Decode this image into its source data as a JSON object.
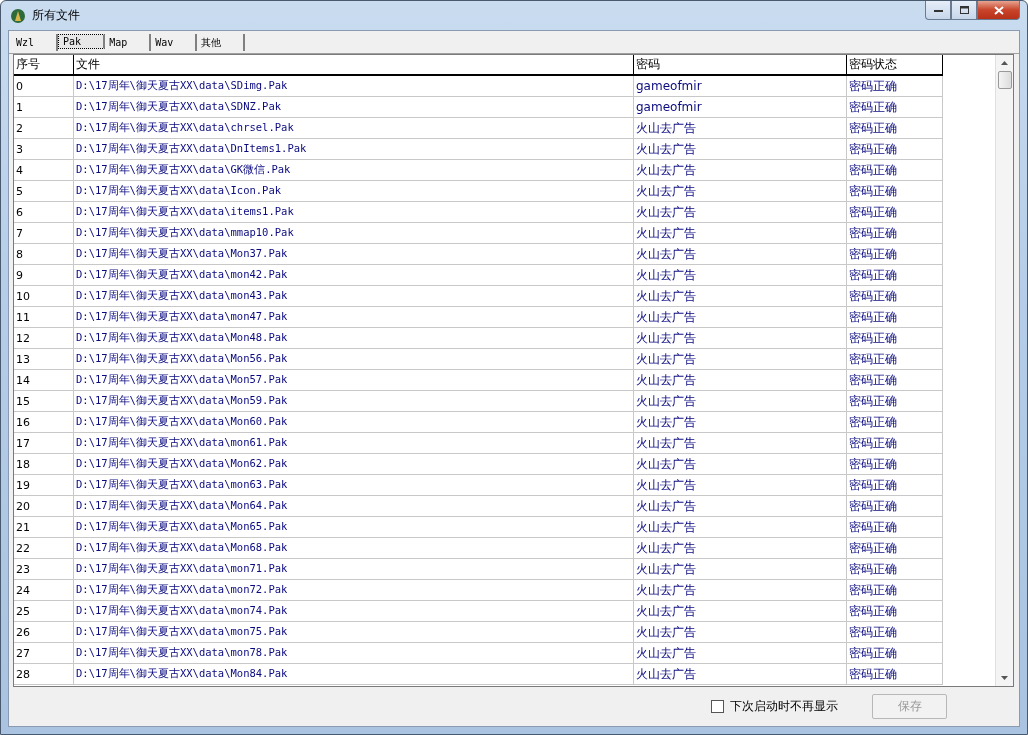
{
  "window": {
    "title": "所有文件"
  },
  "tabs": [
    {
      "label": "Wzl",
      "selected": false
    },
    {
      "label": "Pak",
      "selected": true
    },
    {
      "label": "Map",
      "selected": false
    },
    {
      "label": "Wav",
      "selected": false
    },
    {
      "label": "其他",
      "selected": false
    }
  ],
  "table": {
    "columns": [
      "序号",
      "文件",
      "密码",
      "密码状态"
    ],
    "rows": [
      {
        "no": "0",
        "file": "D:\\17周年\\御天夏古XX\\data\\SDimg.Pak",
        "password": "gameofmir",
        "status": "密码正确"
      },
      {
        "no": "1",
        "file": "D:\\17周年\\御天夏古XX\\data\\SDNZ.Pak",
        "password": "gameofmir",
        "status": "密码正确"
      },
      {
        "no": "2",
        "file": "D:\\17周年\\御天夏古XX\\data\\chrsel.Pak",
        "password": "火山去广告",
        "status": "密码正确"
      },
      {
        "no": "3",
        "file": "D:\\17周年\\御天夏古XX\\data\\DnItems1.Pak",
        "password": "火山去广告",
        "status": "密码正确"
      },
      {
        "no": "4",
        "file": "D:\\17周年\\御天夏古XX\\data\\GK微信.Pak",
        "password": "火山去广告",
        "status": "密码正确"
      },
      {
        "no": "5",
        "file": "D:\\17周年\\御天夏古XX\\data\\Icon.Pak",
        "password": "火山去广告",
        "status": "密码正确"
      },
      {
        "no": "6",
        "file": "D:\\17周年\\御天夏古XX\\data\\items1.Pak",
        "password": "火山去广告",
        "status": "密码正确"
      },
      {
        "no": "7",
        "file": "D:\\17周年\\御天夏古XX\\data\\mmap10.Pak",
        "password": "火山去广告",
        "status": "密码正确"
      },
      {
        "no": "8",
        "file": "D:\\17周年\\御天夏古XX\\data\\Mon37.Pak",
        "password": "火山去广告",
        "status": "密码正确"
      },
      {
        "no": "9",
        "file": "D:\\17周年\\御天夏古XX\\data\\mon42.Pak",
        "password": "火山去广告",
        "status": "密码正确"
      },
      {
        "no": "10",
        "file": "D:\\17周年\\御天夏古XX\\data\\mon43.Pak",
        "password": "火山去广告",
        "status": "密码正确"
      },
      {
        "no": "11",
        "file": "D:\\17周年\\御天夏古XX\\data\\mon47.Pak",
        "password": "火山去广告",
        "status": "密码正确"
      },
      {
        "no": "12",
        "file": "D:\\17周年\\御天夏古XX\\data\\Mon48.Pak",
        "password": "火山去广告",
        "status": "密码正确"
      },
      {
        "no": "13",
        "file": "D:\\17周年\\御天夏古XX\\data\\Mon56.Pak",
        "password": "火山去广告",
        "status": "密码正确"
      },
      {
        "no": "14",
        "file": "D:\\17周年\\御天夏古XX\\data\\Mon57.Pak",
        "password": "火山去广告",
        "status": "密码正确"
      },
      {
        "no": "15",
        "file": "D:\\17周年\\御天夏古XX\\data\\Mon59.Pak",
        "password": "火山去广告",
        "status": "密码正确"
      },
      {
        "no": "16",
        "file": "D:\\17周年\\御天夏古XX\\data\\Mon60.Pak",
        "password": "火山去广告",
        "status": "密码正确"
      },
      {
        "no": "17",
        "file": "D:\\17周年\\御天夏古XX\\data\\mon61.Pak",
        "password": "火山去广告",
        "status": "密码正确"
      },
      {
        "no": "18",
        "file": "D:\\17周年\\御天夏古XX\\data\\Mon62.Pak",
        "password": "火山去广告",
        "status": "密码正确"
      },
      {
        "no": "19",
        "file": "D:\\17周年\\御天夏古XX\\data\\mon63.Pak",
        "password": "火山去广告",
        "status": "密码正确"
      },
      {
        "no": "20",
        "file": "D:\\17周年\\御天夏古XX\\data\\Mon64.Pak",
        "password": "火山去广告",
        "status": "密码正确"
      },
      {
        "no": "21",
        "file": "D:\\17周年\\御天夏古XX\\data\\Mon65.Pak",
        "password": "火山去广告",
        "status": "密码正确"
      },
      {
        "no": "22",
        "file": "D:\\17周年\\御天夏古XX\\data\\Mon68.Pak",
        "password": "火山去广告",
        "status": "密码正确"
      },
      {
        "no": "23",
        "file": "D:\\17周年\\御天夏古XX\\data\\mon71.Pak",
        "password": "火山去广告",
        "status": "密码正确"
      },
      {
        "no": "24",
        "file": "D:\\17周年\\御天夏古XX\\data\\mon72.Pak",
        "password": "火山去广告",
        "status": "密码正确"
      },
      {
        "no": "25",
        "file": "D:\\17周年\\御天夏古XX\\data\\mon74.Pak",
        "password": "火山去广告",
        "status": "密码正确"
      },
      {
        "no": "26",
        "file": "D:\\17周年\\御天夏古XX\\data\\mon75.Pak",
        "password": "火山去广告",
        "status": "密码正确"
      },
      {
        "no": "27",
        "file": "D:\\17周年\\御天夏古XX\\data\\mon78.Pak",
        "password": "火山去广告",
        "status": "密码正确"
      },
      {
        "no": "28",
        "file": "D:\\17周年\\御天夏古XX\\data\\Mon84.Pak",
        "password": "火山去广告",
        "status": "密码正确"
      }
    ]
  },
  "footer": {
    "checkbox": {
      "label": "下次启动时不再显示",
      "checked": false
    },
    "save_button": {
      "label": "保存",
      "disabled": true
    }
  }
}
